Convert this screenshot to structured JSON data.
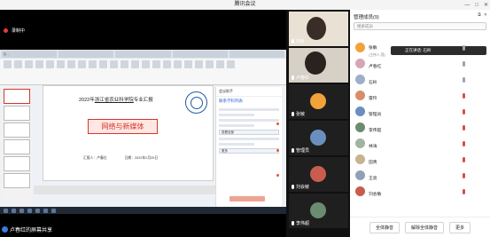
{
  "window": {
    "title": "腾讯会议",
    "controls": [
      "—",
      "□",
      "✕"
    ]
  },
  "share": {
    "recording_label": "录制中",
    "presenter_label": "卢春红的屏幕共享",
    "tabs": [
      "Q ...",
      " ",
      " ",
      " ",
      " "
    ],
    "slide": {
      "title_pre": "2022年",
      "title_org": "浙江省农业科学院",
      "title_post": "专业汇报",
      "box_text": "网络与新媒体",
      "reporter": "汇报人：卢春红",
      "date": "日期：2022年2月25日"
    },
    "panel": {
      "head": "会议助手",
      "title": "联系学科列表",
      "items": [
        "查看全部",
        "更多"
      ]
    }
  },
  "videos": [
    {
      "name": "石岭",
      "bg": "#e9e1d4"
    },
    {
      "name": "卢春红",
      "bg": "#d6d0c6"
    },
    {
      "name": "张敏",
      "bg": "#1f1f1f",
      "avatar": "#f2a23a"
    },
    {
      "name": "管理员",
      "bg": "#1f1f1f",
      "avatar": "#6a8fbf"
    },
    {
      "name": "刘会敏",
      "bg": "#1f1f1f",
      "avatar": "#c75d4e"
    },
    {
      "name": "李伟超",
      "bg": "#1f1f1f",
      "avatar": "#6b8c6f"
    }
  ],
  "members": {
    "title": "管理成员(9)",
    "search_placeholder": "搜索成员",
    "speaking_label": "正在讲话: 石岭",
    "list": [
      {
        "name": "张敏",
        "sub": "(主持人,我)",
        "color": "#f2a23a",
        "mic": "on"
      },
      {
        "name": "卢春红",
        "sub": "",
        "color": "#d6a6b8",
        "mic": "on"
      },
      {
        "name": "石岭",
        "sub": "",
        "color": "#9bb0c7",
        "mic": "on"
      },
      {
        "name": "雷玲",
        "sub": "",
        "color": "#d98c6a",
        "mic": "off"
      },
      {
        "name": "管理员",
        "sub": "",
        "color": "#6a8fbf",
        "mic": "off"
      },
      {
        "name": "李伟超",
        "sub": "",
        "color": "#6b8c6f",
        "mic": "off"
      },
      {
        "name": "林涛",
        "sub": "",
        "color": "#a0b4a0",
        "mic": "off"
      },
      {
        "name": "田青",
        "sub": "",
        "color": "#c9b28f",
        "mic": "off"
      },
      {
        "name": "王亮",
        "sub": "",
        "color": "#8fa0b8",
        "mic": "off"
      },
      {
        "name": "刘会敏",
        "sub": "",
        "color": "#c75d4e",
        "mic": "off"
      }
    ],
    "buttons": [
      "全体静音",
      "解除全体静音",
      "更多"
    ]
  }
}
